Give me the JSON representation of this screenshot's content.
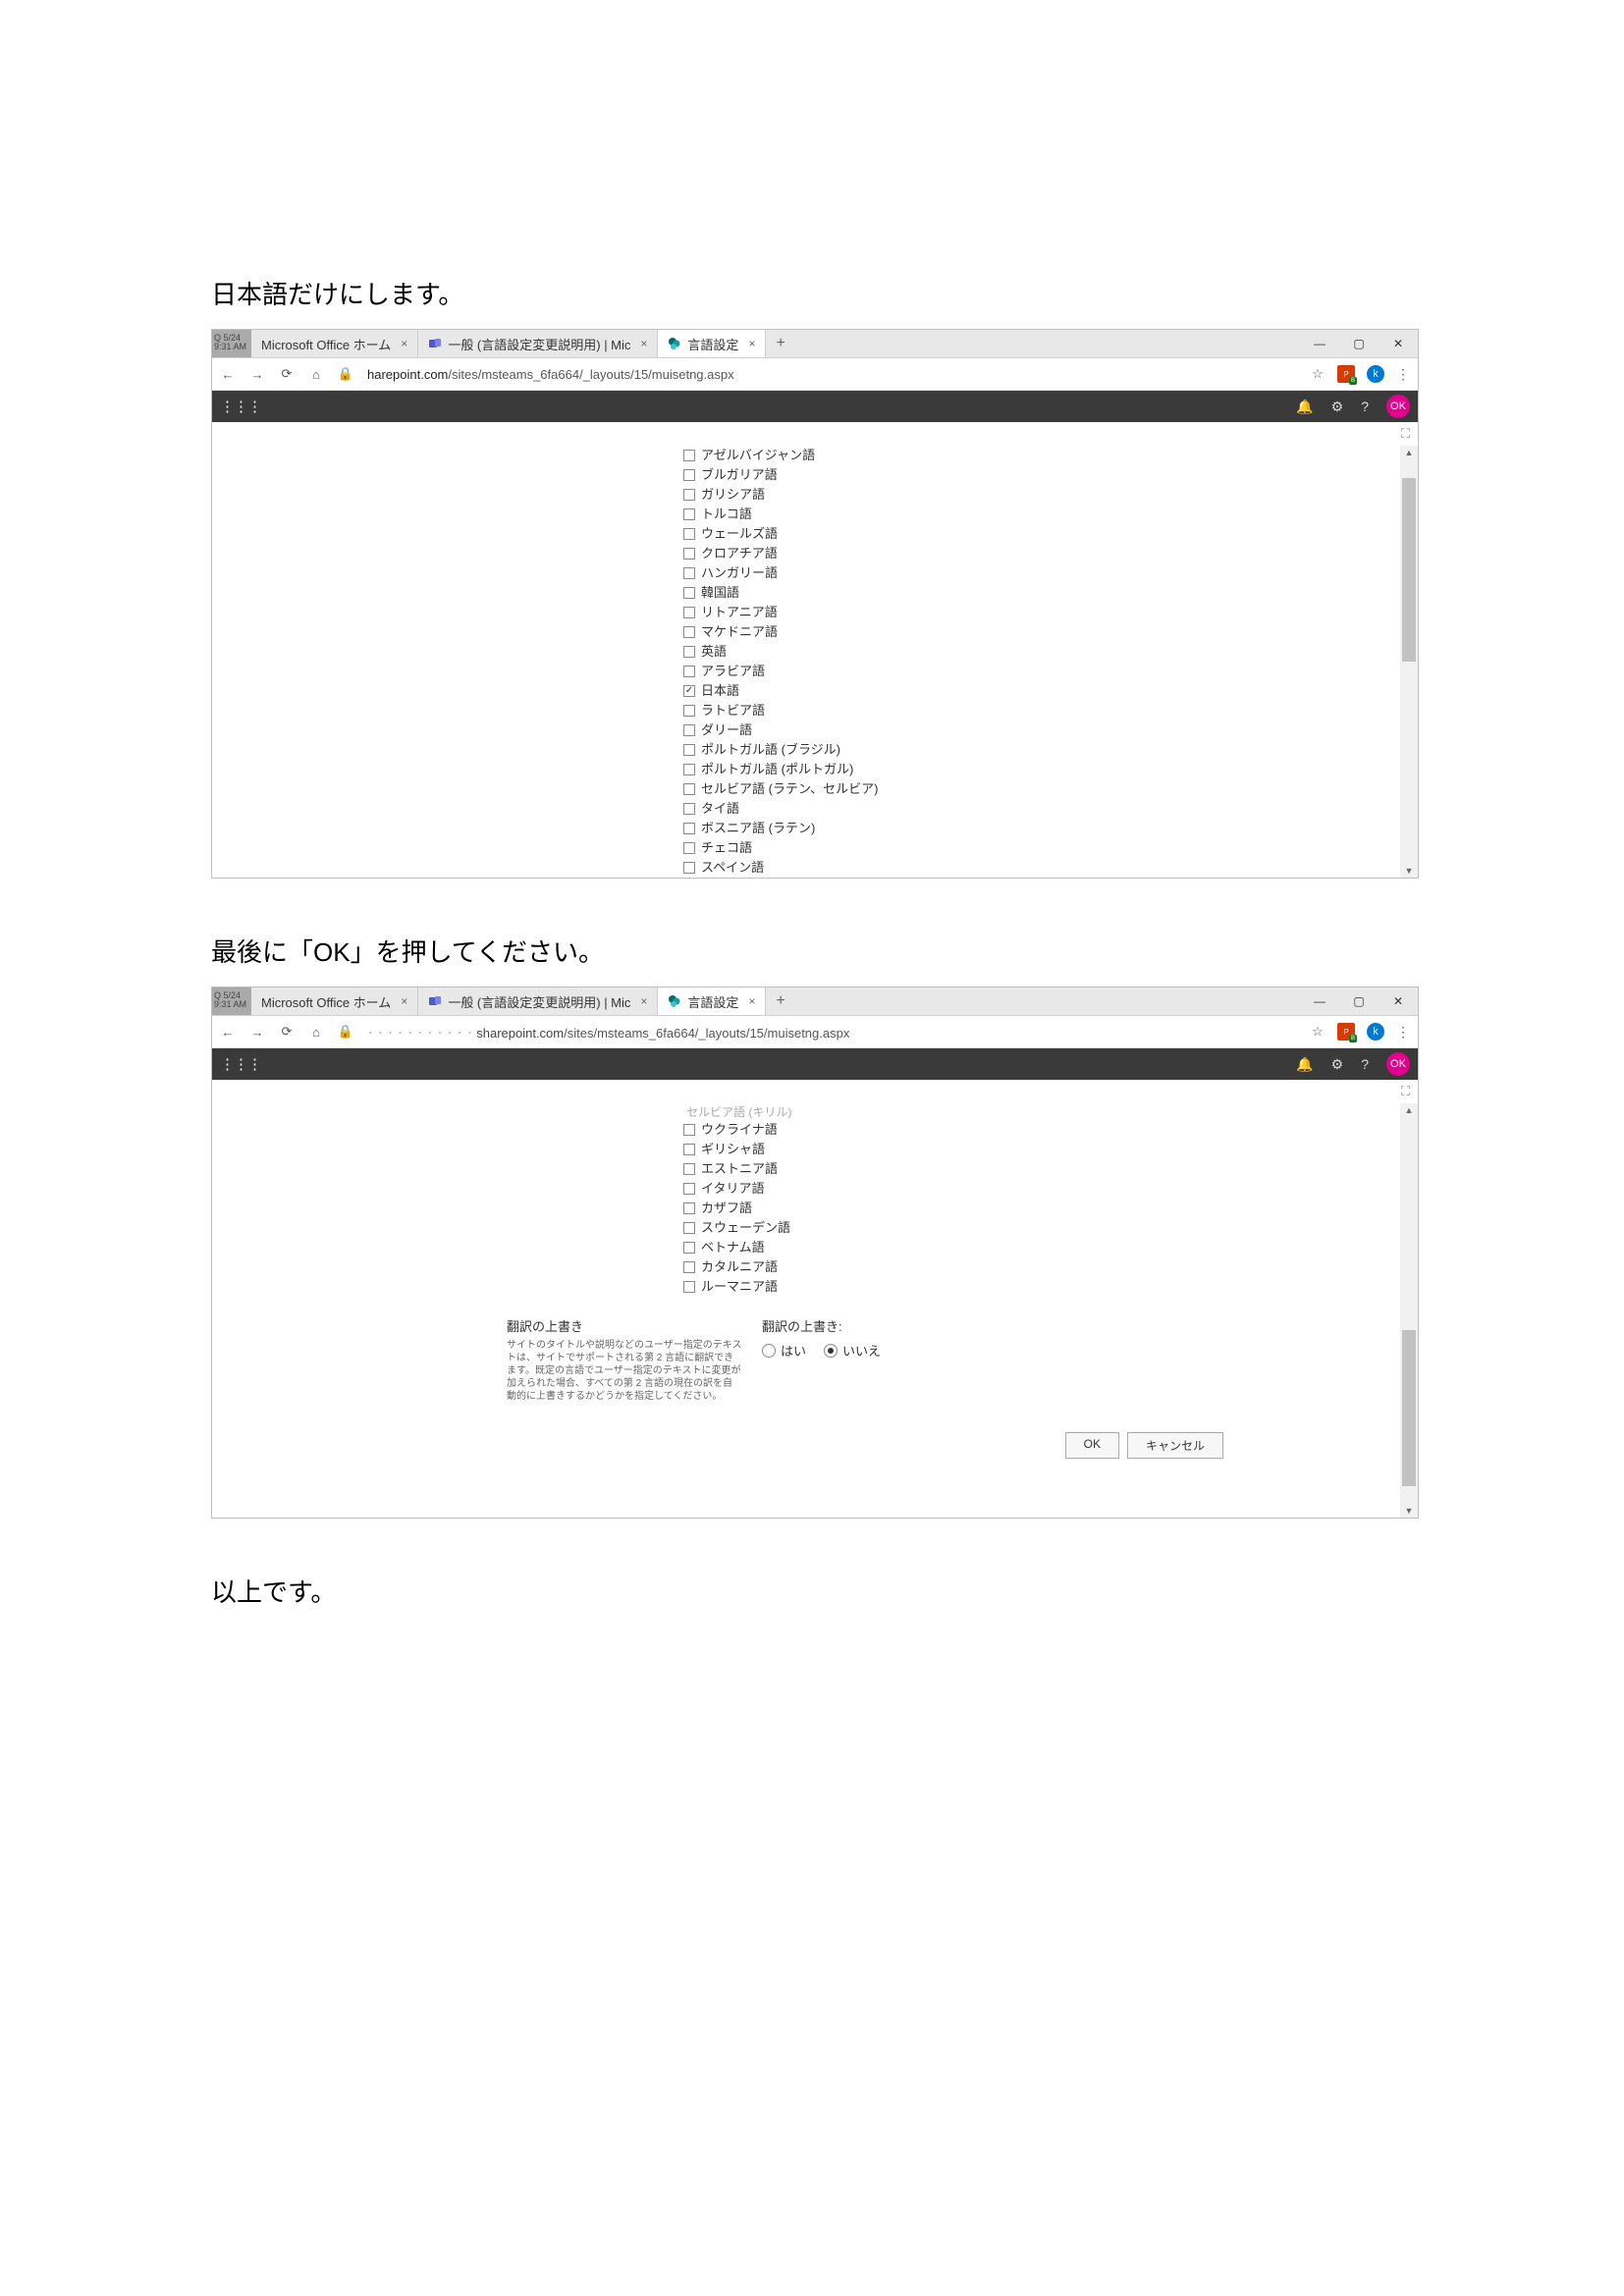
{
  "captions": {
    "c1": "日本語だけにします。",
    "c2": "最後に「OK」を押してください。",
    "c3": "以上です。"
  },
  "browser": {
    "snip_label": "Q 5/24\n9:31 AM",
    "tab1": "Microsoft Office ホーム",
    "tab2": "一般 (言語設定変更説明用) | Mic",
    "tab3": "言語設定",
    "url_prefix": "harepoint.com",
    "url_path": "/sites/msteams_6fa664/_layouts/15/muisetng.aspx",
    "ok_badge": "OK",
    "avatar": "k"
  },
  "s1_languages": [
    {
      "label": "アゼルバイジャン語",
      "checked": false
    },
    {
      "label": "ブルガリア語",
      "checked": false
    },
    {
      "label": "ガリシア語",
      "checked": false
    },
    {
      "label": "トルコ語",
      "checked": false
    },
    {
      "label": "ウェールズ語",
      "checked": false
    },
    {
      "label": "クロアチア語",
      "checked": false
    },
    {
      "label": "ハンガリー語",
      "checked": false
    },
    {
      "label": "韓国語",
      "checked": false
    },
    {
      "label": "リトアニア語",
      "checked": false
    },
    {
      "label": "マケドニア語",
      "checked": false
    },
    {
      "label": "英語",
      "checked": false
    },
    {
      "label": "アラビア語",
      "checked": false
    },
    {
      "label": "日本語",
      "checked": true
    },
    {
      "label": "ラトビア語",
      "checked": false
    },
    {
      "label": "ダリー語",
      "checked": false
    },
    {
      "label": "ポルトガル語 (ブラジル)",
      "checked": false
    },
    {
      "label": "ポルトガル語 (ポルトガル)",
      "checked": false
    },
    {
      "label": "セルビア語 (ラテン、セルビア)",
      "checked": false
    },
    {
      "label": "タイ語",
      "checked": false
    },
    {
      "label": "ボスニア語 (ラテン)",
      "checked": false
    },
    {
      "label": "チェコ語",
      "checked": false
    },
    {
      "label": "スペイン語",
      "checked": false
    }
  ],
  "s2_cutoff": "セルビア語 (キリル)",
  "s2_languages": [
    {
      "label": "ウクライナ語",
      "checked": false
    },
    {
      "label": "ギリシャ語",
      "checked": false
    },
    {
      "label": "エストニア語",
      "checked": false
    },
    {
      "label": "イタリア語",
      "checked": false
    },
    {
      "label": "カザフ語",
      "checked": false
    },
    {
      "label": "スウェーデン語",
      "checked": false
    },
    {
      "label": "ベトナム語",
      "checked": false
    },
    {
      "label": "カタルニア語",
      "checked": false
    },
    {
      "label": "ルーマニア語",
      "checked": false
    }
  ],
  "overwrite": {
    "title": "翻訳の上書き",
    "desc": "サイトのタイトルや説明などのユーザー指定のテキストは、サイトでサポートされる第 2 言語に翻訳できます。既定の言語でユーザー指定のテキストに変更が加えられた場合、すべての第 2 言語の現在の訳を自動的に上書きするかどうかを指定してください。",
    "label": "翻訳の上書き:",
    "yes": "はい",
    "no": "いいえ"
  },
  "buttons": {
    "ok": "OK",
    "cancel": "キャンセル"
  }
}
